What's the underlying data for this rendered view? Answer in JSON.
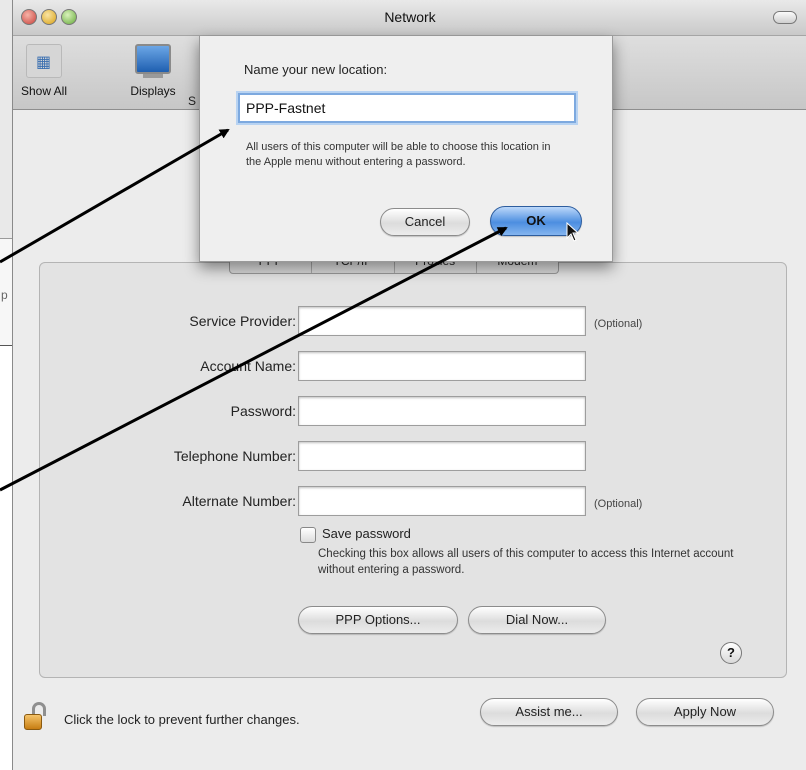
{
  "window": {
    "title": "Network"
  },
  "toolbar": {
    "show_all": "Show All",
    "displays": "Displays",
    "cut_label": "S"
  },
  "background_window": {
    "fragment": "p"
  },
  "tabs": [
    "PPP",
    "TCP/IP",
    "Proxies",
    "Modem"
  ],
  "form": {
    "fields": [
      {
        "label": "Service Provider:",
        "value": "",
        "note": "(Optional)"
      },
      {
        "label": "Account Name:",
        "value": "",
        "note": ""
      },
      {
        "label": "Password:",
        "value": "",
        "note": ""
      },
      {
        "label": "Telephone Number:",
        "value": "",
        "note": ""
      },
      {
        "label": "Alternate Number:",
        "value": "",
        "note": "(Optional)"
      }
    ],
    "save_password": {
      "label": "Save password",
      "checked": false,
      "help": "Checking this box allows all users of this computer to access this Internet account without entering a password."
    },
    "ppp_options": "PPP Options...",
    "dial_now": "Dial Now...",
    "help": "?"
  },
  "footer": {
    "lock_text": "Click the lock to prevent further changes.",
    "assist": "Assist me...",
    "apply": "Apply Now"
  },
  "sheet": {
    "prompt": "Name your new location:",
    "name_value": "PPP-Fastnet",
    "note": "All users of this computer will be able to choose this location in the Apple menu without entering a password.",
    "cancel": "Cancel",
    "ok": "OK"
  },
  "colors": {
    "accent": "#4c8ee0",
    "focus_ring": "#7da9df"
  },
  "icons": [
    "apple-logo-icon",
    "display-monitor-icon",
    "lock-icon",
    "arrow-pointer-icon",
    "help-icon"
  ]
}
